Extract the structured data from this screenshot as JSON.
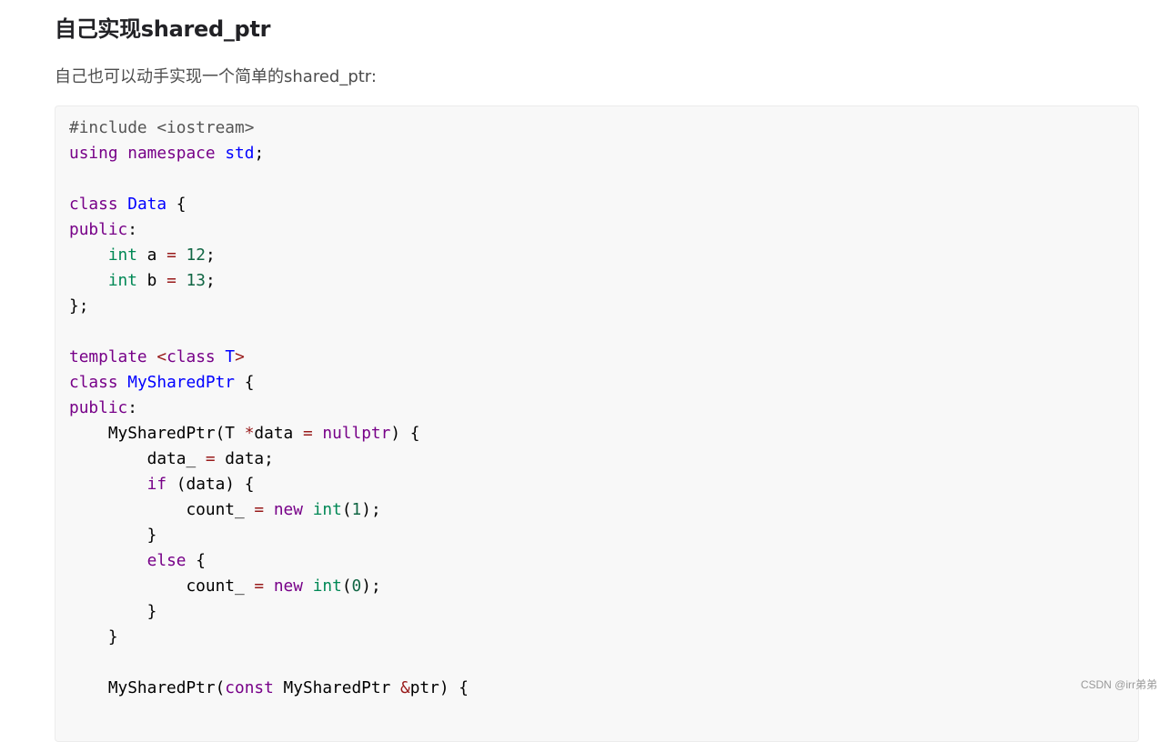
{
  "heading": "自己实现shared_ptr",
  "intro": "自己也可以动手实现一个简单的shared_ptr:",
  "watermark": "CSDN @irr弟弟",
  "colors": {
    "keyword": "#770088",
    "definition": "#0000ff",
    "type": "#008855",
    "number": "#116644",
    "operator": "#981a1a",
    "meta": "#555555",
    "code_bg": "#f8f8f8"
  },
  "code_lines": [
    [
      [
        "meta",
        "#include <iostream>"
      ]
    ],
    [
      [
        "kw",
        "using"
      ],
      [
        "pl",
        " "
      ],
      [
        "kw",
        "namespace"
      ],
      [
        "pl",
        " "
      ],
      [
        "def",
        "std"
      ],
      [
        "pl",
        ";"
      ]
    ],
    [],
    [
      [
        "kw",
        "class"
      ],
      [
        "pl",
        " "
      ],
      [
        "def",
        "Data"
      ],
      [
        "pl",
        " {"
      ]
    ],
    [
      [
        "kw",
        "public"
      ],
      [
        "pl",
        ":"
      ]
    ],
    [
      [
        "pl",
        "    "
      ],
      [
        "ty",
        "int"
      ],
      [
        "pl",
        " a "
      ],
      [
        "op",
        "="
      ],
      [
        "pl",
        " "
      ],
      [
        "num",
        "12"
      ],
      [
        "pl",
        ";"
      ]
    ],
    [
      [
        "pl",
        "    "
      ],
      [
        "ty",
        "int"
      ],
      [
        "pl",
        " b "
      ],
      [
        "op",
        "="
      ],
      [
        "pl",
        " "
      ],
      [
        "num",
        "13"
      ],
      [
        "pl",
        ";"
      ]
    ],
    [
      [
        "pl",
        "};"
      ]
    ],
    [],
    [
      [
        "kw",
        "template"
      ],
      [
        "pl",
        " "
      ],
      [
        "op",
        "<"
      ],
      [
        "kw",
        "class"
      ],
      [
        "pl",
        " "
      ],
      [
        "def",
        "T"
      ],
      [
        "op",
        ">"
      ]
    ],
    [
      [
        "kw",
        "class"
      ],
      [
        "pl",
        " "
      ],
      [
        "def",
        "MySharedPtr"
      ],
      [
        "pl",
        " {"
      ]
    ],
    [
      [
        "kw",
        "public"
      ],
      [
        "pl",
        ":"
      ]
    ],
    [
      [
        "pl",
        "    MySharedPtr(T "
      ],
      [
        "op",
        "*"
      ],
      [
        "pl",
        "data "
      ],
      [
        "op",
        "="
      ],
      [
        "pl",
        " "
      ],
      [
        "kw",
        "nullptr"
      ],
      [
        "pl",
        ") {"
      ]
    ],
    [
      [
        "pl",
        "        data_ "
      ],
      [
        "op",
        "="
      ],
      [
        "pl",
        " data;"
      ]
    ],
    [
      [
        "pl",
        "        "
      ],
      [
        "kw",
        "if"
      ],
      [
        "pl",
        " (data) {"
      ]
    ],
    [
      [
        "pl",
        "            count_ "
      ],
      [
        "op",
        "="
      ],
      [
        "pl",
        " "
      ],
      [
        "kw",
        "new"
      ],
      [
        "pl",
        " "
      ],
      [
        "ty",
        "int"
      ],
      [
        "pl",
        "("
      ],
      [
        "num",
        "1"
      ],
      [
        "pl",
        ");"
      ]
    ],
    [
      [
        "pl",
        "        }"
      ]
    ],
    [
      [
        "pl",
        "        "
      ],
      [
        "kw",
        "else"
      ],
      [
        "pl",
        " {"
      ]
    ],
    [
      [
        "pl",
        "            count_ "
      ],
      [
        "op",
        "="
      ],
      [
        "pl",
        " "
      ],
      [
        "kw",
        "new"
      ],
      [
        "pl",
        " "
      ],
      [
        "ty",
        "int"
      ],
      [
        "pl",
        "("
      ],
      [
        "num",
        "0"
      ],
      [
        "pl",
        ");"
      ]
    ],
    [
      [
        "pl",
        "        }"
      ]
    ],
    [
      [
        "pl",
        "    }"
      ]
    ],
    [],
    [
      [
        "pl",
        "    MySharedPtr("
      ],
      [
        "kw",
        "const"
      ],
      [
        "pl",
        " MySharedPtr "
      ],
      [
        "op",
        "&"
      ],
      [
        "pl",
        "ptr) {"
      ]
    ]
  ]
}
